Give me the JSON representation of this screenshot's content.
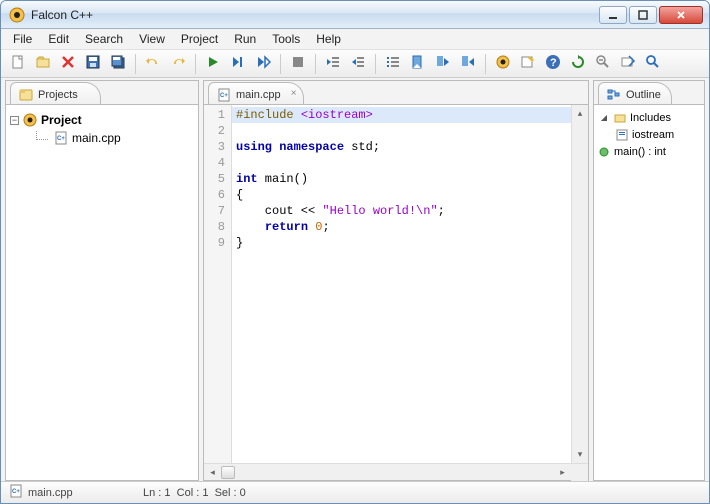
{
  "window": {
    "title": "Falcon C++"
  },
  "menu": [
    "File",
    "Edit",
    "Search",
    "View",
    "Project",
    "Run",
    "Tools",
    "Help"
  ],
  "toolbar_icons": [
    "new-file",
    "open-file",
    "delete-file",
    "save",
    "save-all",
    "|",
    "undo",
    "redo",
    "|",
    "run",
    "step-over",
    "step-to-cursor",
    "|",
    "stop",
    "|",
    "outdent",
    "indent",
    "|",
    "list",
    "bookmark-toggle",
    "bookmark-prev",
    "bookmark-next",
    "|",
    "settings",
    "insert",
    "help",
    "refresh",
    "zoom-out",
    "goto",
    "find"
  ],
  "projects": {
    "tab_label": "Projects",
    "root": "Project",
    "children": [
      {
        "name": "main.cpp",
        "icon": "cpp-file"
      }
    ]
  },
  "editor": {
    "tab_label": "main.cpp",
    "lines": [
      {
        "n": 1,
        "tokens": [
          [
            "pre",
            "#include "
          ],
          [
            "str",
            "<iostream>"
          ]
        ]
      },
      {
        "n": 2,
        "tokens": []
      },
      {
        "n": 3,
        "tokens": [
          [
            "kw",
            "using"
          ],
          [
            "",
            " "
          ],
          [
            "kw",
            "namespace"
          ],
          [
            "",
            " std;"
          ]
        ]
      },
      {
        "n": 4,
        "tokens": []
      },
      {
        "n": 5,
        "tokens": [
          [
            "kw",
            "int"
          ],
          [
            "",
            " main()"
          ]
        ]
      },
      {
        "n": 6,
        "tokens": [
          [
            "",
            "{"
          ]
        ]
      },
      {
        "n": 7,
        "tokens": [
          [
            "",
            "    cout << "
          ],
          [
            "str",
            "\"Hello world!\\n\""
          ],
          [
            "",
            ";"
          ]
        ]
      },
      {
        "n": 8,
        "tokens": [
          [
            "",
            "    "
          ],
          [
            "kw",
            "return"
          ],
          [
            "",
            " "
          ],
          [
            "num",
            "0"
          ],
          [
            "",
            ";"
          ]
        ]
      },
      {
        "n": 9,
        "tokens": [
          [
            "",
            "}"
          ]
        ]
      }
    ],
    "highlight_line": 1
  },
  "outline": {
    "tab_label": "Outline",
    "items": [
      {
        "icon": "folder",
        "label": "Includes",
        "expanded": true,
        "children": [
          {
            "icon": "header",
            "label": "iostream"
          }
        ]
      },
      {
        "icon": "func",
        "label": "main() : int"
      }
    ]
  },
  "status": {
    "file": "main.cpp",
    "ln": "Ln : 1",
    "col": "Col : 1",
    "sel": "Sel : 0"
  }
}
